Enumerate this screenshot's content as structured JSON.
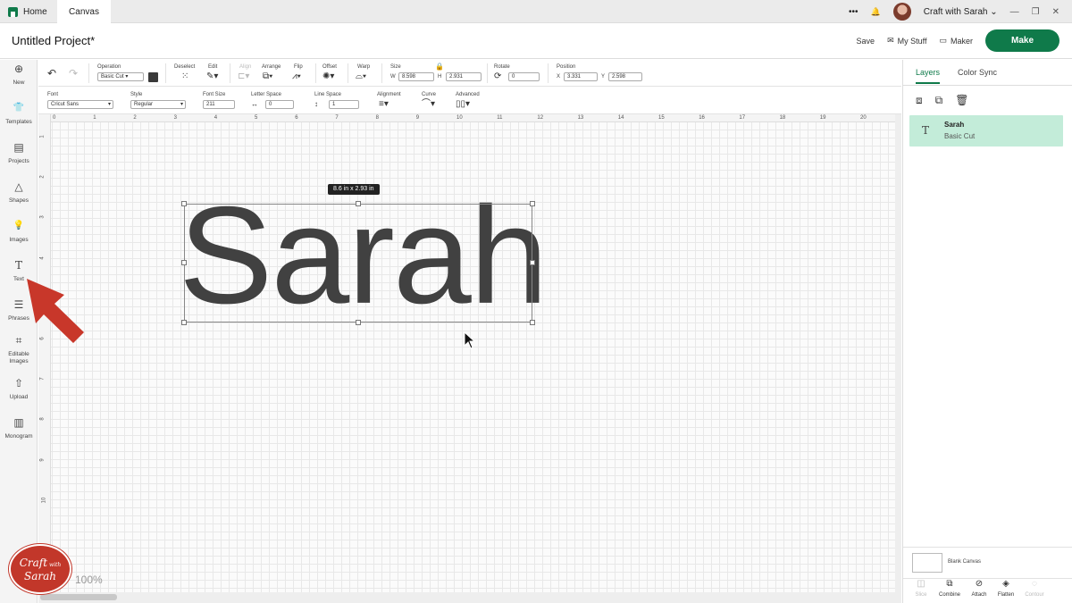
{
  "tabs": {
    "home": "Home",
    "canvas": "Canvas"
  },
  "topbar": {
    "user_name": "Craft with Sarah",
    "more": "•••",
    "bell": "🔔",
    "minimize": "—",
    "restore": "❐",
    "close": "✕"
  },
  "header": {
    "title": "Untitled Project*",
    "save": "Save",
    "my_stuff": "My Stuff",
    "maker": "Maker",
    "make": "Make"
  },
  "left_tools": [
    {
      "label": "New",
      "icon": "⊕"
    },
    {
      "label": "Templates",
      "icon": "👕"
    },
    {
      "label": "Projects",
      "icon": "▤"
    },
    {
      "label": "Shapes",
      "icon": "△"
    },
    {
      "label": "Images",
      "icon": "💡"
    },
    {
      "label": "Text",
      "icon": "T"
    },
    {
      "label": "Phrases",
      "icon": "☰"
    },
    {
      "label": "Editable Images",
      "icon": "⌗"
    },
    {
      "label": "Upload",
      "icon": "⇧"
    },
    {
      "label": "Monogram",
      "icon": "▥"
    }
  ],
  "edit1": {
    "operation_label": "Operation",
    "operation_value": "Basic Cut",
    "color": "#3a3a3a",
    "deselect": "Deselect",
    "edit": "Edit",
    "align": "Align",
    "arrange": "Arrange",
    "flip": "Flip",
    "offset": "Offset",
    "warp": "Warp",
    "size": "Size",
    "w_label": "W",
    "w_value": "8.598",
    "h_label": "H",
    "h_value": "2.931",
    "rotate": "Rotate",
    "rotate_value": "0",
    "position": "Position",
    "x_label": "X",
    "x_value": "3.331",
    "y_label": "Y",
    "y_value": "2.598"
  },
  "edit2": {
    "font_label": "Font",
    "font_value": "Cricut Sans",
    "style_label": "Style",
    "style_value": "Regular",
    "font_size_label": "Font Size",
    "font_size_value": "211",
    "letter_space_label": "Letter Space",
    "letter_space_value": "0",
    "line_space_label": "Line Space",
    "line_space_value": "1",
    "alignment_label": "Alignment",
    "curve_label": "Curve",
    "advanced_label": "Advanced"
  },
  "ruler": {
    "top": [
      "0",
      "1",
      "2",
      "3",
      "4",
      "5",
      "6",
      "7",
      "8",
      "9",
      "10",
      "11",
      "12",
      "13",
      "14",
      "15",
      "16",
      "17",
      "18",
      "19",
      "20"
    ],
    "left": [
      "1",
      "2",
      "3",
      "4",
      "5",
      "6",
      "7",
      "8",
      "9",
      "10"
    ]
  },
  "canvas": {
    "text": "Sarah",
    "size_tip": "8.6  in x 2.93  in",
    "zoom": "100%"
  },
  "logo": {
    "line1": "Craft",
    "line2": "with",
    "line3": "Sarah"
  },
  "panel": {
    "tab_layers": "Layers",
    "tab_color_sync": "Color Sync",
    "layer_name": "Sarah",
    "layer_operation": "Basic Cut",
    "blank_canvas": "Blank Canvas",
    "footer": [
      {
        "label": "Slice",
        "icon": "◫",
        "enabled": false
      },
      {
        "label": "Combine",
        "icon": "⧉",
        "enabled": true
      },
      {
        "label": "Attach",
        "icon": "⊘",
        "enabled": true
      },
      {
        "label": "Flatten",
        "icon": "◈",
        "enabled": true
      },
      {
        "label": "Contour",
        "icon": "◌",
        "enabled": false
      }
    ]
  },
  "colors": {
    "accent": "#0f7a4a",
    "layer_highlight": "#c3ecd9",
    "arrow": "#c8372a"
  }
}
